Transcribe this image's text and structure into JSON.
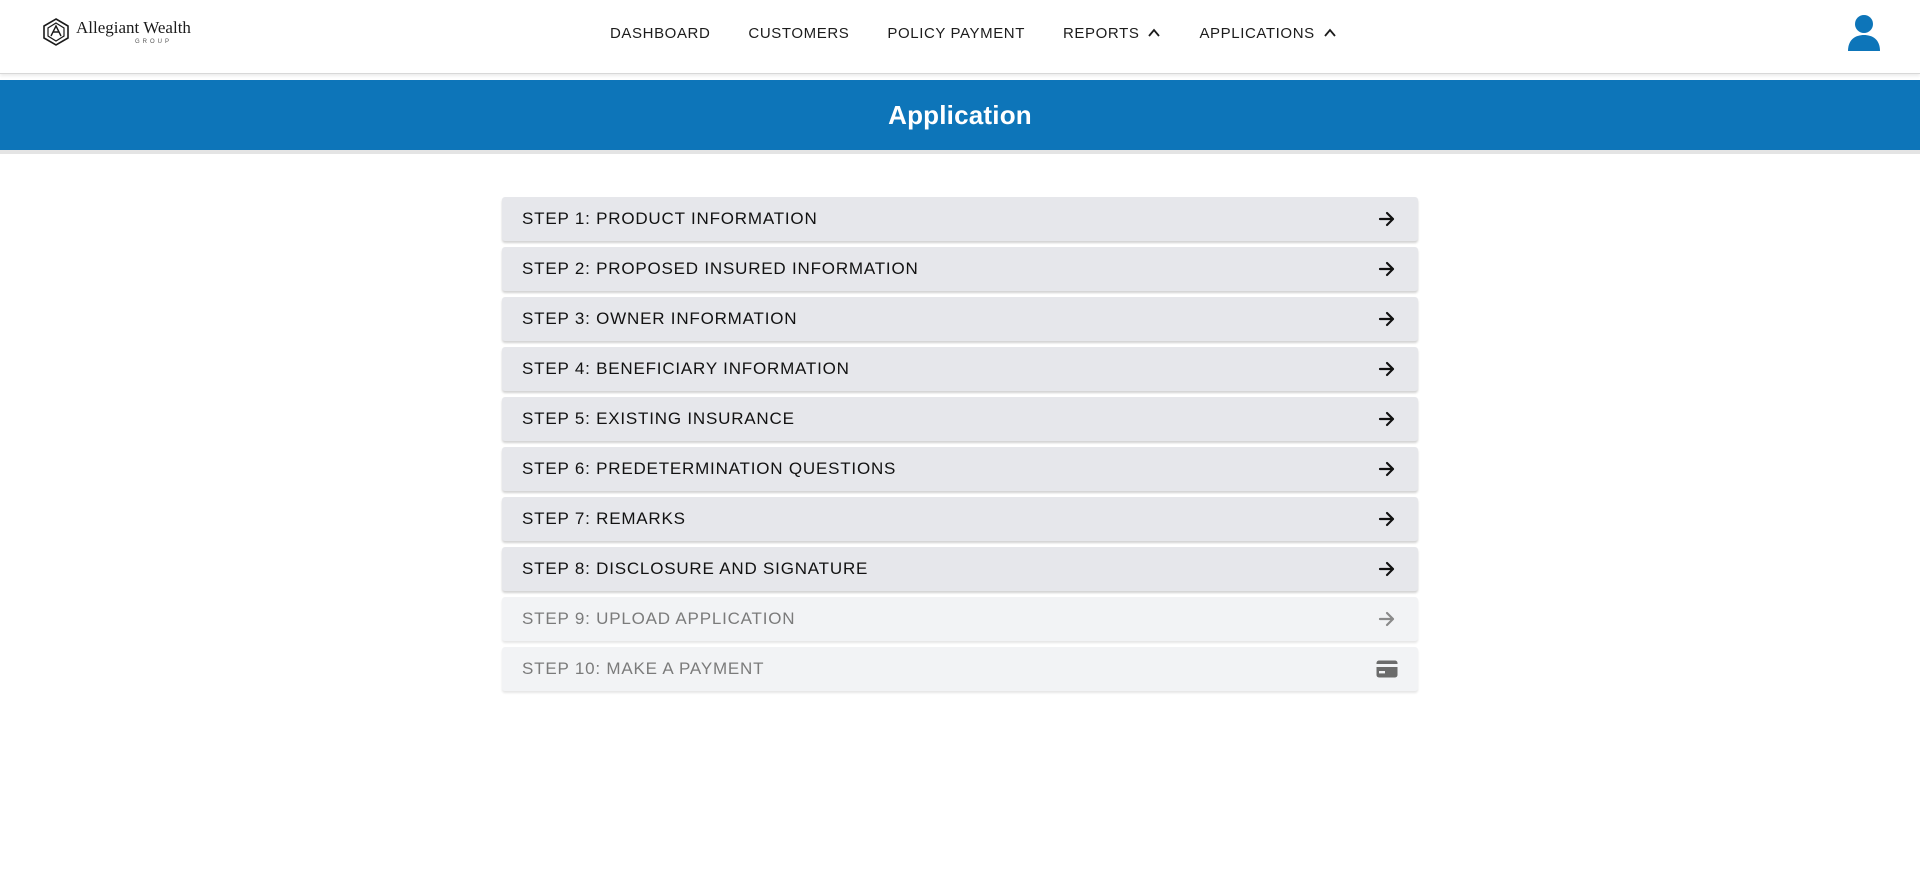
{
  "brand": {
    "name": "Allegiant Wealth",
    "sub": "GROUP"
  },
  "nav": {
    "items": [
      {
        "label": "DASHBOARD"
      },
      {
        "label": "CUSTOMERS"
      },
      {
        "label": "POLICY PAYMENT"
      },
      {
        "label": "REPORTS"
      },
      {
        "label": "APPLICATIONS"
      }
    ]
  },
  "banner": {
    "title": "Application"
  },
  "steps": [
    {
      "label": "STEP 1: PRODUCT INFORMATION",
      "icon": "arrow-right-icon",
      "enabled": true
    },
    {
      "label": "STEP 2: PROPOSED INSURED INFORMATION",
      "icon": "arrow-right-icon",
      "enabled": true
    },
    {
      "label": "STEP 3: OWNER INFORMATION",
      "icon": "arrow-right-icon",
      "enabled": true
    },
    {
      "label": "STEP 4: BENEFICIARY INFORMATION",
      "icon": "arrow-right-icon",
      "enabled": true
    },
    {
      "label": "STEP 5: EXISTING INSURANCE",
      "icon": "arrow-right-icon",
      "enabled": true
    },
    {
      "label": "STEP 6: PREDETERMINATION QUESTIONS",
      "icon": "arrow-right-icon",
      "enabled": true
    },
    {
      "label": "STEP 7: REMARKS",
      "icon": "arrow-right-icon",
      "enabled": true
    },
    {
      "label": "STEP 8: DISCLOSURE AND SIGNATURE",
      "icon": "arrow-right-icon",
      "enabled": true
    },
    {
      "label": "STEP 9: UPLOAD APPLICATION",
      "icon": "arrow-right-icon",
      "enabled": false
    },
    {
      "label": "STEP 10: MAKE A PAYMENT",
      "icon": "credit-card-icon",
      "enabled": false
    }
  ],
  "colors": {
    "banner": "#0d75b9",
    "user_icon": "#0d75b9",
    "step_bg": "#e6e7eb",
    "step_disabled_bg": "#f2f3f5"
  }
}
